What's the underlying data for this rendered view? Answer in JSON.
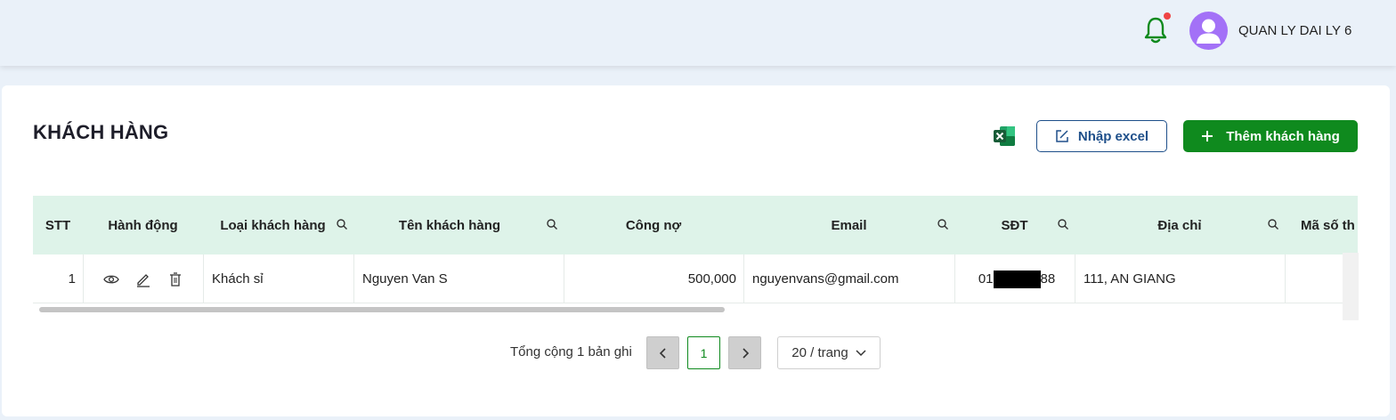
{
  "header": {
    "username": "QUAN LY DAI LY 6",
    "bell_color": "#0f8a1e",
    "notification_dot_color": "#ef4444",
    "avatar_color": "#a371f7"
  },
  "page": {
    "title": "KHÁCH HÀNG"
  },
  "toolbar": {
    "import_label": "Nhập excel",
    "add_label": "Thêm khách hàng",
    "accent_color": "#0f8a1e",
    "import_color": "#1e4f8a"
  },
  "table": {
    "columns": [
      {
        "label": "STT",
        "searchable": false
      },
      {
        "label": "Hành động",
        "searchable": false
      },
      {
        "label": "Loại khách hàng",
        "searchable": true
      },
      {
        "label": "Tên khách hàng",
        "searchable": true
      },
      {
        "label": "Công nợ",
        "searchable": false
      },
      {
        "label": "Email",
        "searchable": true
      },
      {
        "label": "SĐT",
        "searchable": true
      },
      {
        "label": "Địa chỉ",
        "searchable": true
      },
      {
        "label": "Mã số th",
        "searchable": false
      }
    ],
    "rows": [
      {
        "stt": "1",
        "type": "Khách sỉ",
        "name": "Nguyen Van S",
        "debt": "500,000",
        "email": "nguyenvans@gmail.com",
        "phone_prefix": "01",
        "phone_suffix": "88",
        "address": "111, AN GIANG",
        "tax_code": ""
      }
    ],
    "header_bg": "#def3e9"
  },
  "pagination": {
    "total_text": "Tổng cộng 1 bản ghi",
    "current_page": "1",
    "page_size": "20 / trang"
  }
}
